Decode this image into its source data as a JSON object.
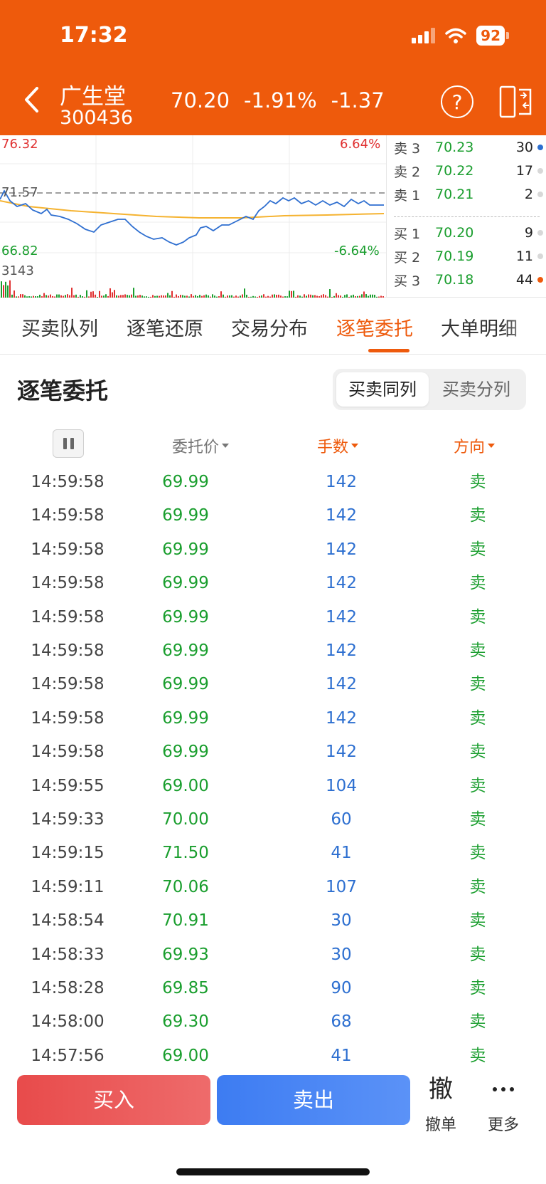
{
  "status_bar": {
    "time": "17:32",
    "battery": "92"
  },
  "header": {
    "stock_name": "广生堂",
    "stock_code": "300436",
    "price": "70.20",
    "change_pct": "-1.91%",
    "change": "-1.37",
    "help_glyph": "?"
  },
  "chart": {
    "high_price": "76.32",
    "high_pct": "6.64%",
    "ref_price": "71.57",
    "low_price": "66.82",
    "low_pct": "-6.64%",
    "volume_max": "3143",
    "colors": {
      "price_line": "#2f6fd0",
      "avg_line": "#f5b331",
      "up": "#e03131",
      "down": "#1a9e2e"
    }
  },
  "order_book": {
    "asks": [
      {
        "name": "卖 3",
        "price": "70.23",
        "vol": "30",
        "dot": "#2d6fd0"
      },
      {
        "name": "卖 2",
        "price": "70.22",
        "vol": "17",
        "dot": "#d8d8d8"
      },
      {
        "name": "卖 1",
        "price": "70.21",
        "vol": "2",
        "dot": "#d8d8d8"
      }
    ],
    "bids": [
      {
        "name": "买 1",
        "price": "70.20",
        "vol": "9",
        "dot": "#d8d8d8"
      },
      {
        "name": "买 2",
        "price": "70.19",
        "vol": "11",
        "dot": "#d8d8d8"
      },
      {
        "name": "买 3",
        "price": "70.18",
        "vol": "44",
        "dot": "#EE5A0C"
      }
    ]
  },
  "tabs": [
    "买卖队列",
    "逐笔还原",
    "交易分布",
    "逐笔委托",
    "大单明细"
  ],
  "active_tab": 3,
  "section": {
    "title": "逐笔委托",
    "seg_same": "买卖同列",
    "seg_split": "买卖分列"
  },
  "table": {
    "headers": {
      "price": "委托价",
      "qty": "手数",
      "dir": "方向"
    },
    "rows": [
      {
        "time": "14:59:58",
        "price": "69.99",
        "qty": "142",
        "dir": "卖"
      },
      {
        "time": "14:59:58",
        "price": "69.99",
        "qty": "142",
        "dir": "卖"
      },
      {
        "time": "14:59:58",
        "price": "69.99",
        "qty": "142",
        "dir": "卖"
      },
      {
        "time": "14:59:58",
        "price": "69.99",
        "qty": "142",
        "dir": "卖"
      },
      {
        "time": "14:59:58",
        "price": "69.99",
        "qty": "142",
        "dir": "卖"
      },
      {
        "time": "14:59:58",
        "price": "69.99",
        "qty": "142",
        "dir": "卖"
      },
      {
        "time": "14:59:58",
        "price": "69.99",
        "qty": "142",
        "dir": "卖"
      },
      {
        "time": "14:59:58",
        "price": "69.99",
        "qty": "142",
        "dir": "卖"
      },
      {
        "time": "14:59:58",
        "price": "69.99",
        "qty": "142",
        "dir": "卖"
      },
      {
        "time": "14:59:55",
        "price": "69.00",
        "qty": "104",
        "dir": "卖"
      },
      {
        "time": "14:59:33",
        "price": "70.00",
        "qty": "60",
        "dir": "卖"
      },
      {
        "time": "14:59:15",
        "price": "71.50",
        "qty": "41",
        "dir": "卖"
      },
      {
        "time": "14:59:11",
        "price": "70.06",
        "qty": "107",
        "dir": "卖"
      },
      {
        "time": "14:58:54",
        "price": "70.91",
        "qty": "30",
        "dir": "卖"
      },
      {
        "time": "14:58:33",
        "price": "69.93",
        "qty": "30",
        "dir": "卖"
      },
      {
        "time": "14:58:28",
        "price": "69.85",
        "qty": "90",
        "dir": "卖"
      },
      {
        "time": "14:58:00",
        "price": "69.30",
        "qty": "68",
        "dir": "卖"
      },
      {
        "time": "14:57:56",
        "price": "69.00",
        "qty": "41",
        "dir": "卖"
      }
    ]
  },
  "bottom_bar": {
    "buy": "买入",
    "sell": "卖出",
    "cancel_icon": "撤",
    "cancel_label": "撤单",
    "more_label": "更多"
  }
}
